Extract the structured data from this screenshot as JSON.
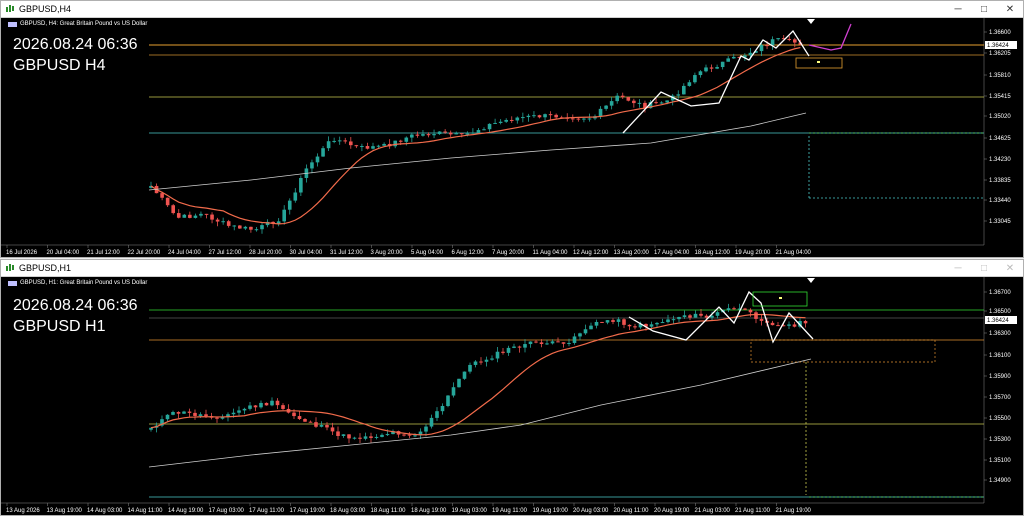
{
  "top": {
    "window_title": "GBPUSD,H4",
    "header_text": "GBPUSD, H4:  Great Britain Pound vs US Dollar",
    "overlay_datetime": "2026.08.24 06:36",
    "overlay_symbol": "GBPUSD H4",
    "price_labels": [
      "1.36600",
      "1.36424",
      "1.36205",
      "1.35810",
      "1.35415",
      "1.35020",
      "1.34625",
      "1.34230",
      "1.33835",
      "1.33440",
      "1.33045"
    ],
    "current_price": "1.36424",
    "time_labels": [
      "16 Jul 2026",
      "20 Jul 04:00",
      "21 Jul 12:00",
      "22 Jul 20:00",
      "24 Jul 04:00",
      "27 Jul 12:00",
      "28 Jul 20:00",
      "30 Jul 04:00",
      "31 Jul 12:00",
      "3 Aug 20:00",
      "5 Aug 04:00",
      "6 Aug 12:00",
      "7 Aug 20:00",
      "11 Aug 04:00",
      "12 Aug 12:00",
      "13 Aug 20:00",
      "17 Aug 04:00",
      "18 Aug 12:00",
      "19 Aug 20:00",
      "21 Aug 04:00"
    ]
  },
  "bottom": {
    "window_title": "GBPUSD,H1",
    "header_text": "GBPUSD, H1:  Great Britain Pound vs US Dollar",
    "overlay_datetime": "2026.08.24 06:36",
    "overlay_symbol": "GBPUSD H1",
    "price_labels": [
      "1.36700",
      "1.36500",
      "1.36424",
      "1.36300",
      "1.36100",
      "1.35900",
      "1.35700",
      "1.35500",
      "1.35300",
      "1.35100",
      "1.34900"
    ],
    "current_price": "1.36424",
    "time_labels": [
      "13 Aug 2026",
      "13 Aug 19:00",
      "14 Aug 03:00",
      "14 Aug 11:00",
      "14 Aug 19:00",
      "17 Aug 03:00",
      "17 Aug 11:00",
      "17 Aug 19:00",
      "18 Aug 03:00",
      "18 Aug 11:00",
      "18 Aug 19:00",
      "19 Aug 03:00",
      "19 Aug 11:00",
      "19 Aug 19:00",
      "20 Aug 03:00",
      "20 Aug 11:00",
      "20 Aug 19:00",
      "21 Aug 03:00",
      "21 Aug 11:00",
      "21 Aug 19:00"
    ]
  },
  "window_buttons": {
    "minimize": "─",
    "maximize": "□",
    "close": "✕"
  },
  "colors": {
    "bull": "#26a69a",
    "bear": "#ef5350",
    "ma_fast": "#f26b4b",
    "ma_slow": "#d0d0d0",
    "zigzag": "#ffffff",
    "level_orange": "#e0902f",
    "level_yellow": "#d8d84a",
    "level_cyan": "#4cc9c9",
    "level_green": "#33dd33"
  }
}
